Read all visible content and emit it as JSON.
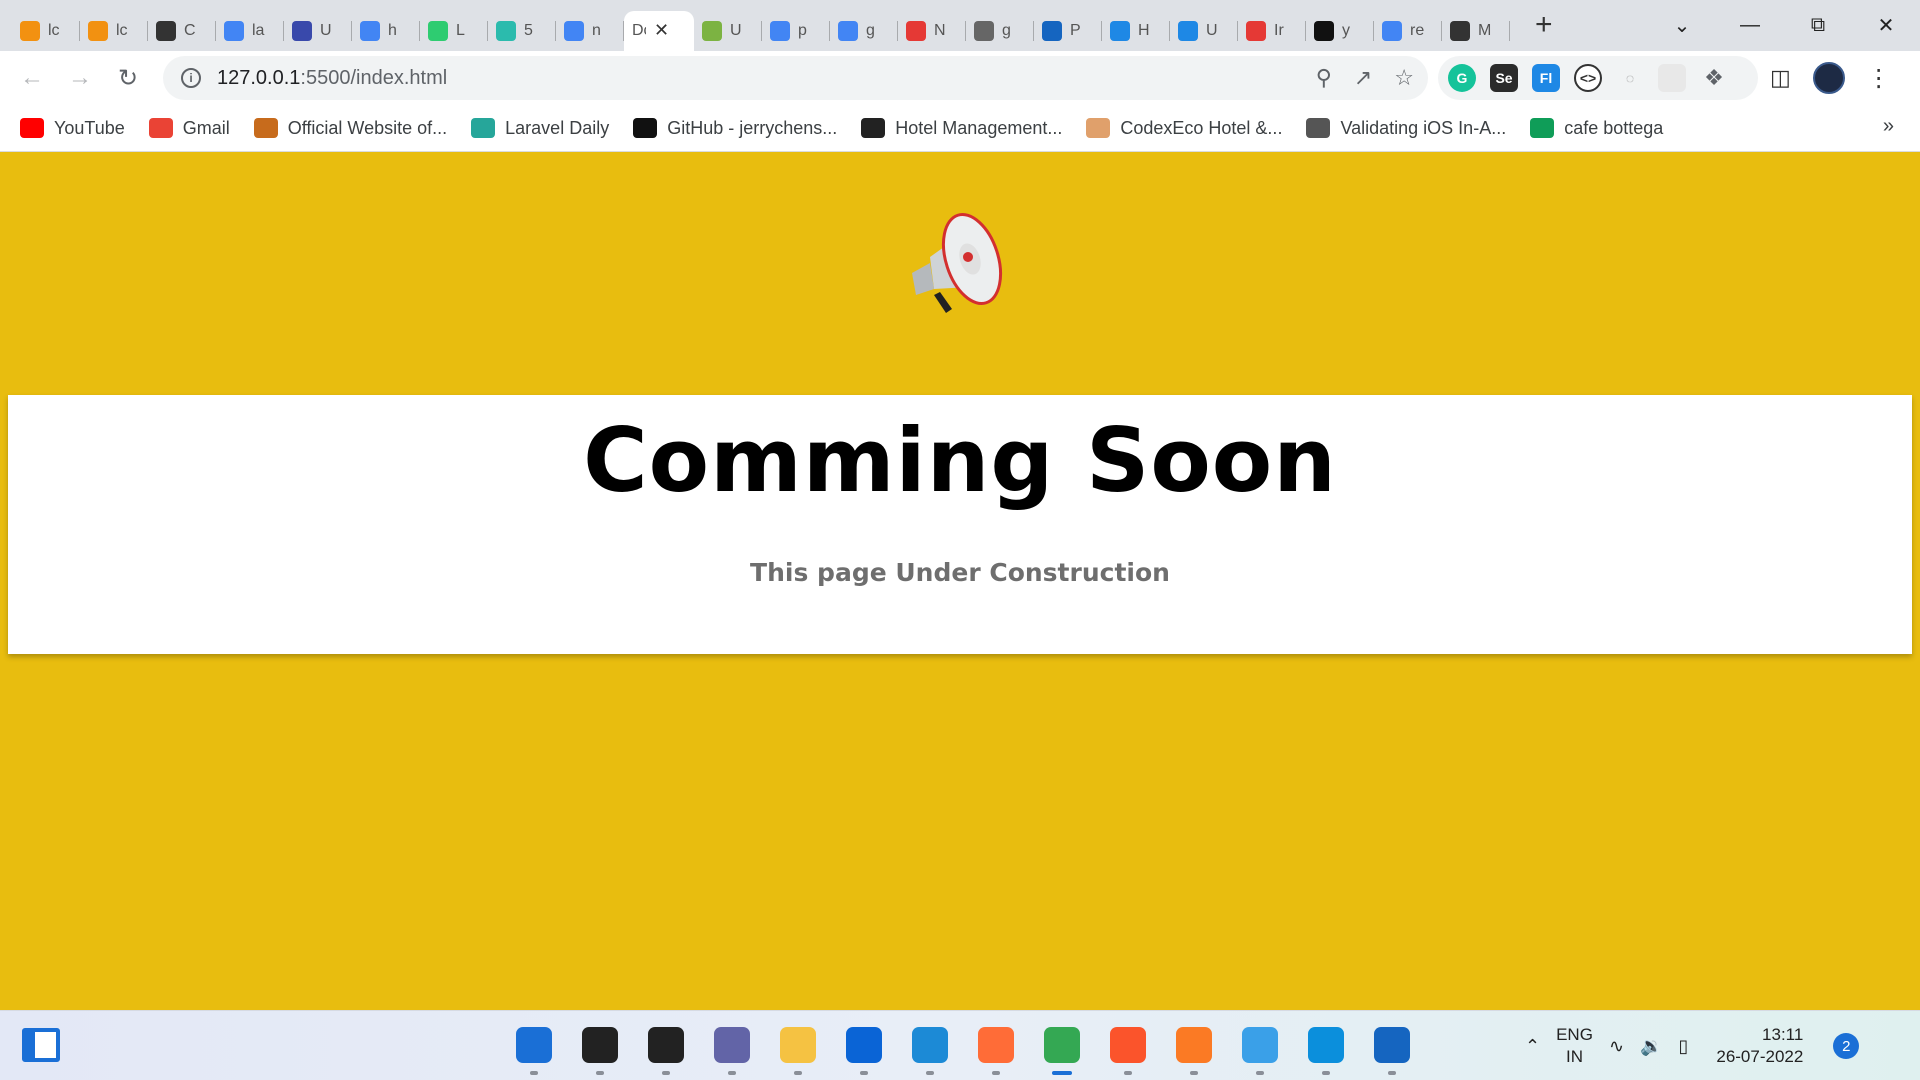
{
  "browser": {
    "tabs": [
      {
        "label": "lc",
        "favicon": "pma-icon",
        "color": "#f29111"
      },
      {
        "label": "lc",
        "favicon": "pma-icon",
        "color": "#f29111"
      },
      {
        "label": "C",
        "favicon": "quill-icon",
        "color": "#333333"
      },
      {
        "label": "la",
        "favicon": "google-icon",
        "color": "#4285f4"
      },
      {
        "label": "U",
        "favicon": "cloud-icon",
        "color": "#3949ab"
      },
      {
        "label": "h",
        "favicon": "google-icon",
        "color": "#4285f4"
      },
      {
        "label": "L",
        "favicon": "play-icon",
        "color": "#2ecc71"
      },
      {
        "label": "5",
        "favicon": "p-icon",
        "color": "#2bbbad"
      },
      {
        "label": "n",
        "favicon": "google-icon",
        "color": "#4285f4"
      },
      {
        "label": "Do",
        "favicon": "",
        "color": "#ffffff",
        "active": true
      },
      {
        "label": "U",
        "favicon": "bracket-icon",
        "color": "#7cb342"
      },
      {
        "label": "p",
        "favicon": "google-icon",
        "color": "#4285f4"
      },
      {
        "label": "g",
        "favicon": "google-icon",
        "color": "#4285f4"
      },
      {
        "label": "N",
        "favicon": "puzzle-icon",
        "color": "#e53935"
      },
      {
        "label": "g",
        "favicon": "globe-icon",
        "color": "#666666"
      },
      {
        "label": "P",
        "favicon": "chart-icon",
        "color": "#1565c0"
      },
      {
        "label": "H",
        "favicon": "c-icon",
        "color": "#1e88e5"
      },
      {
        "label": "U",
        "favicon": "c-icon",
        "color": "#1e88e5"
      },
      {
        "label": "Ir",
        "favicon": "gauge-icon",
        "color": "#e53935"
      },
      {
        "label": "y",
        "favicon": "github-icon",
        "color": "#111111"
      },
      {
        "label": "re",
        "favicon": "google-icon",
        "color": "#4285f4"
      },
      {
        "label": "M",
        "favicon": "markdown-icon",
        "color": "#333333"
      }
    ],
    "url_host": "127.0.0.1",
    "url_rest": ":5500/index.html",
    "bookmarks": [
      {
        "label": "YouTube",
        "icon": "youtube-icon",
        "color": "#ff0000"
      },
      {
        "label": "Gmail",
        "icon": "gmail-icon",
        "color": "#ea4335"
      },
      {
        "label": "Official Website of...",
        "icon": "emblem-icon",
        "color": "#c76b1c"
      },
      {
        "label": "Laravel Daily",
        "icon": "laravel-daily-icon",
        "color": "#26a69a"
      },
      {
        "label": "GitHub - jerrychens...",
        "icon": "github-icon",
        "color": "#111111"
      },
      {
        "label": "Hotel Management...",
        "icon": "hotel-icon",
        "color": "#222222"
      },
      {
        "label": "CodexEco Hotel &...",
        "icon": "hand-icon",
        "color": "#e0a06b"
      },
      {
        "label": "Validating iOS In-A...",
        "icon": "globe-icon",
        "color": "#555555"
      },
      {
        "label": "cafe bottega",
        "icon": "sheets-icon",
        "color": "#0f9d58"
      }
    ]
  },
  "page": {
    "title": "Comming Soon",
    "subtitle": "This page Under Construction",
    "background": "#e8bd0f"
  },
  "taskbar": {
    "apps": [
      {
        "name": "windows-start-icon",
        "color": "#1a6fd6"
      },
      {
        "name": "search-icon",
        "color": "#222222"
      },
      {
        "name": "task-view-icon",
        "color": "#222222"
      },
      {
        "name": "teams-chat-icon",
        "color": "#6264a7"
      },
      {
        "name": "file-explorer-icon",
        "color": "#f5c242"
      },
      {
        "name": "mail-icon",
        "color": "#0a64d6"
      },
      {
        "name": "vscode-icon",
        "color": "#1c8ad6"
      },
      {
        "name": "postman-icon",
        "color": "#ff6c37"
      },
      {
        "name": "chrome-icon",
        "color": "#34a853",
        "active": true
      },
      {
        "name": "brave-icon",
        "color": "#fb542b"
      },
      {
        "name": "xampp-icon",
        "color": "#fb7a24"
      },
      {
        "name": "notepad-icon",
        "color": "#3aa0e8"
      },
      {
        "name": "skype-icon",
        "color": "#0b8fdc"
      },
      {
        "name": "photos-icon",
        "color": "#1565c0"
      }
    ],
    "lang_line1": "ENG",
    "lang_line2": "IN",
    "time": "13:11",
    "date": "26-07-2022",
    "notifications": "2"
  }
}
